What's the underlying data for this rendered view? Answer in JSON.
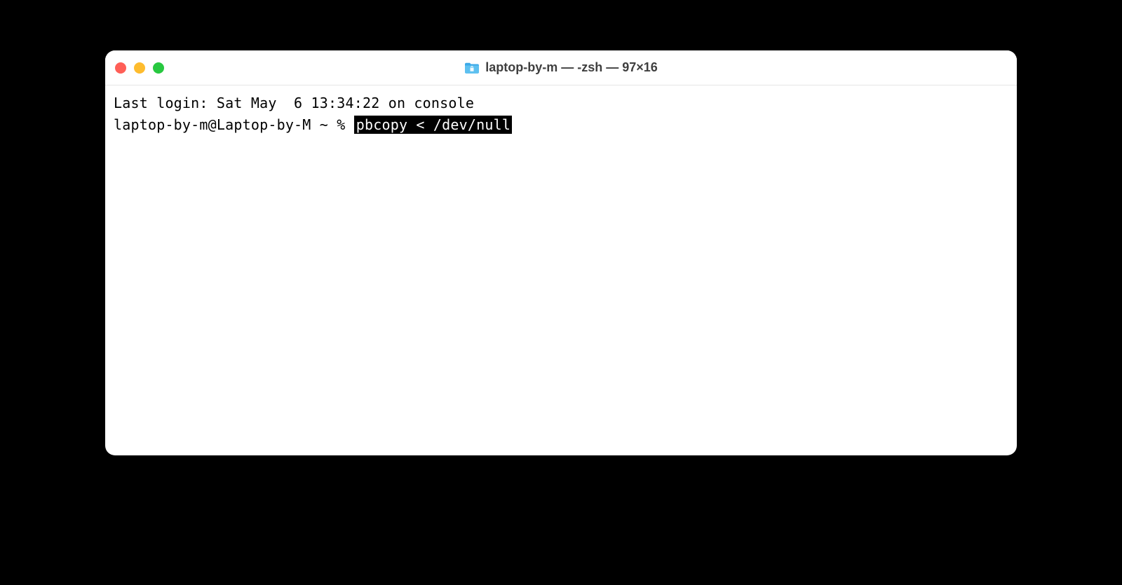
{
  "window": {
    "title": "laptop-by-m — -zsh — 97×16"
  },
  "terminal": {
    "last_login": "Last login: Sat May  6 13:34:22 on console",
    "prompt": "laptop-by-m@Laptop-by-M ~ % ",
    "command": "pbcopy < /dev/null"
  }
}
